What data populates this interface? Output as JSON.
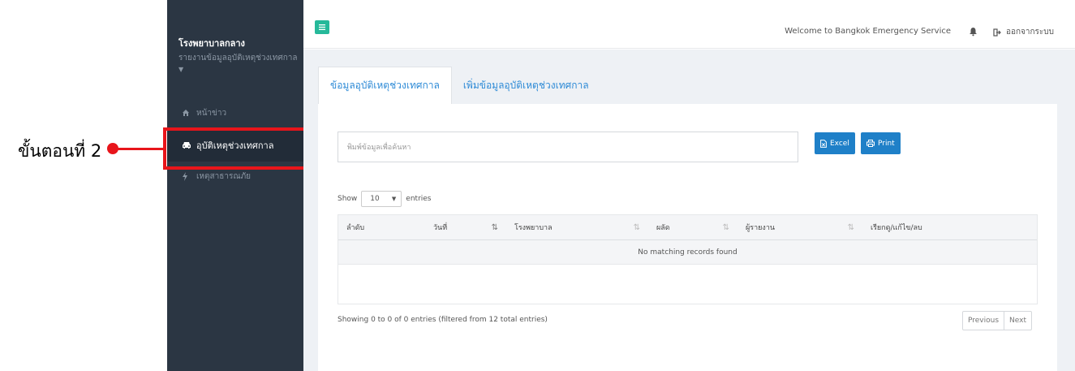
{
  "annotation": {
    "step_label": "ขั้นตอนที่ 2"
  },
  "sidebar": {
    "title": "โรงพยาบาลกลาง",
    "subtitle": "รายงานข้อมูลอุบัติเหตุช่วงเทศกาล",
    "items": [
      {
        "label": "หน้าข่าว",
        "icon": "home-icon"
      },
      {
        "label": "อุบัติเหตุช่วงเทศกาล",
        "icon": "car-icon",
        "active": true
      },
      {
        "label": "เหตุสาธารณภัย",
        "icon": "bolt-icon"
      }
    ]
  },
  "topbar": {
    "welcome": "Welcome to Bangkok Emergency Service",
    "logout": "ออกจากระบบ"
  },
  "tabs": [
    {
      "label": "ข้อมูลอุบัติเหตุช่วงเทศกาล",
      "active": true
    },
    {
      "label": "เพิ่มข้อมูลอุบัติเหตุช่วงเทศกาล"
    }
  ],
  "search": {
    "placeholder": "พิมพ์ข้อมูลเพื่อค้นหา"
  },
  "buttons": {
    "excel": "Excel",
    "print": "Print"
  },
  "length": {
    "show": "Show",
    "value": "10",
    "entries": "entries"
  },
  "table": {
    "columns": [
      "ลำดับ",
      "วันที่",
      "โรงพยาบาล",
      "ผลัด",
      "ผู้รายงาน",
      "เรียกดู/แก้ไข/ลบ"
    ],
    "empty": "No matching records found"
  },
  "info": "Showing 0 to 0 of 0 entries (filtered from 12 total entries)",
  "pager": {
    "previous": "Previous",
    "next": "Next"
  },
  "colors": {
    "sidebar": "#2b3643",
    "accent": "#26b99a",
    "primary": "#1f80c8",
    "highlight": "#e8151b"
  }
}
